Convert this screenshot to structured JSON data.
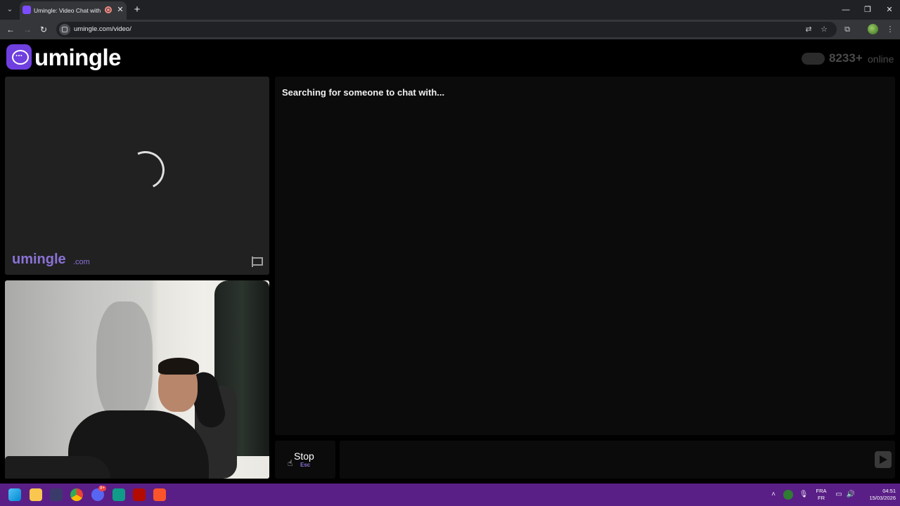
{
  "browser": {
    "tab_title": "Umingle: Video Chat with S",
    "url": "umingle.com/video/",
    "new_tab_symbol": "+",
    "close_symbol": "✕"
  },
  "site": {
    "logo_text": "umingle",
    "online_count": "8233+",
    "online_label": "online"
  },
  "remote": {
    "watermark": "umingle",
    "watermark_suffix": ".com"
  },
  "chat": {
    "status": "Searching for someone to chat with...",
    "message_placeholder": ""
  },
  "controls": {
    "stop_label": "Stop",
    "stop_shortcut": "Esc"
  },
  "taskbar": {
    "lang_primary": "FRA",
    "lang_secondary": "FR",
    "time": "04:51",
    "date": "15/03/2026",
    "discord_badge": "9+"
  },
  "colors": {
    "brand_purple": "#6f3fe0",
    "taskbar": "#5a1f86"
  }
}
